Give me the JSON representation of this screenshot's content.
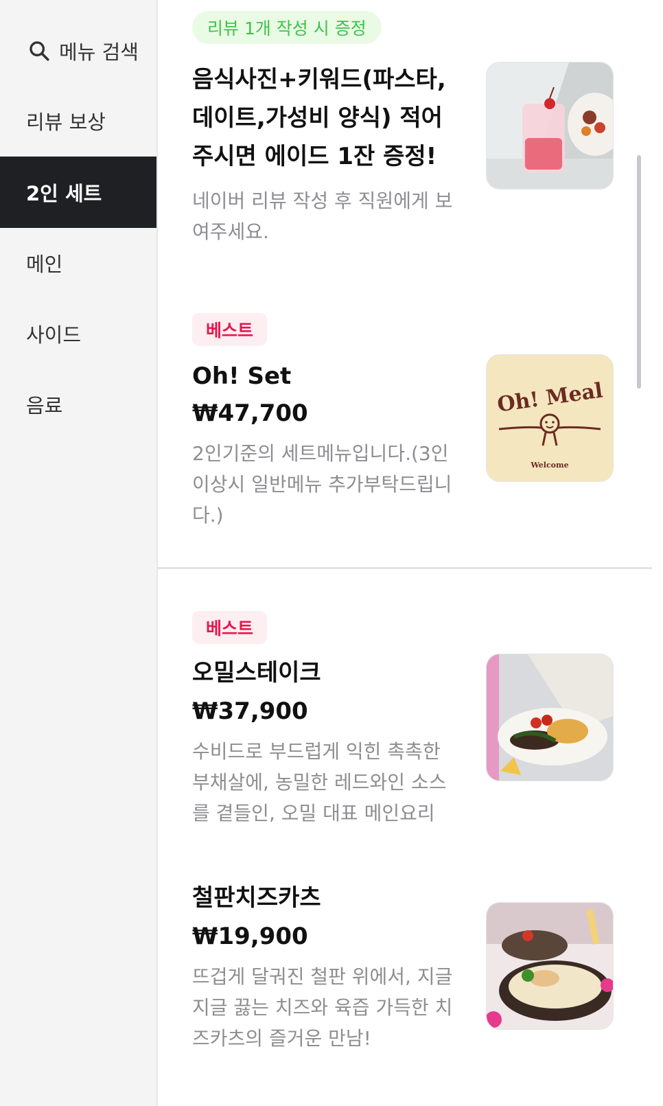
{
  "sidebar": {
    "search_label": "메뉴 검색",
    "items": [
      {
        "label": "리뷰 보상"
      },
      {
        "label": "2인 세트"
      },
      {
        "label": "메인"
      },
      {
        "label": "사이드"
      },
      {
        "label": "음료"
      }
    ],
    "active_index": 1
  },
  "menu": [
    {
      "badge": "리뷰 1개 작성 시 증정",
      "title": "음식사진+키워드(파스타, 데이트,가성비 양식) 적어주시면 에이드 1잔 증정!",
      "description": "네이버 리뷰 작성 후 직원에게 보여주세요."
    },
    {
      "badge": "베스트",
      "title": "Oh! Set",
      "price": "₩47,700",
      "description": "2인기준의 세트메뉴입니다.(3인이상시 일반메뉴 추가부탁드립니다.)",
      "logo_text": "Oh! Meal",
      "logo_subtext": "Welcome"
    },
    {
      "badge": "베스트",
      "title": "오밀스테이크",
      "price": "₩37,900",
      "description": "수비드로 부드럽게 익힌 촉촉한 부채살에, 농밀한 레드와인 소스를 곁들인, 오밀 대표 메인요리"
    },
    {
      "title": "철판치즈카츠",
      "price": "₩19,900",
      "description": "뜨겁게 달궈진 철판 위에서, 지글지글 끓는 치즈와 육즙 가득한 치즈카츠의 즐거운 만남!"
    }
  ],
  "colors": {
    "sidebar_active_bg": "#1f2023",
    "best_badge_text": "#e5174e",
    "review_badge_text": "#3ec24b"
  }
}
